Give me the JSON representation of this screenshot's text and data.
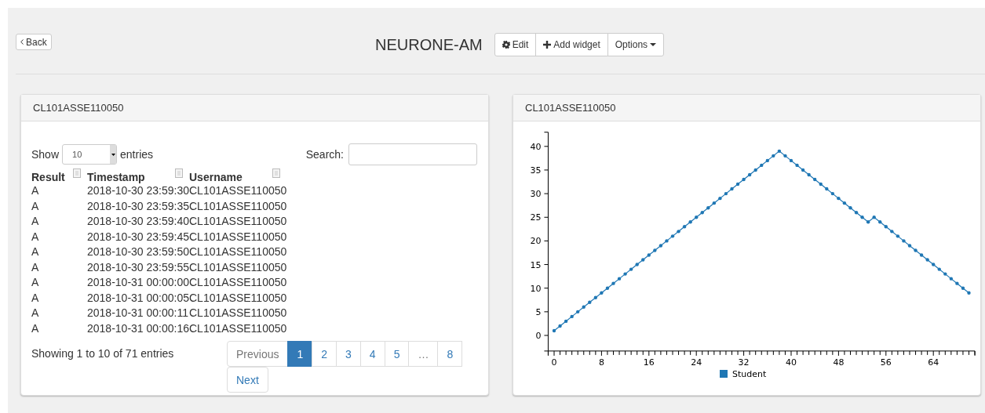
{
  "header": {
    "back": "Back",
    "title": "NEURONE-AM",
    "buttons": [
      {
        "label": "Edit",
        "kind": "gear"
      },
      {
        "label": "Add widget",
        "kind": "plus"
      },
      {
        "label": "Options",
        "kind": "caret"
      }
    ]
  },
  "table_widget": {
    "title": "CL101ASSE110050",
    "length": {
      "before": "Show",
      "value": "10",
      "after": "entries"
    },
    "search": {
      "label": "Search:"
    },
    "columns": [
      "Result",
      "Timestamp",
      "Username"
    ],
    "rows": [
      [
        "A",
        "2018-10-30 23:59:30",
        "CL101ASSE110050"
      ],
      [
        "A",
        "2018-10-30 23:59:35",
        "CL101ASSE110050"
      ],
      [
        "A",
        "2018-10-30 23:59:40",
        "CL101ASSE110050"
      ],
      [
        "A",
        "2018-10-30 23:59:45",
        "CL101ASSE110050"
      ],
      [
        "A",
        "2018-10-30 23:59:50",
        "CL101ASSE110050"
      ],
      [
        "A",
        "2018-10-30 23:59:55",
        "CL101ASSE110050"
      ],
      [
        "A",
        "2018-10-31 00:00:00",
        "CL101ASSE110050"
      ],
      [
        "A",
        "2018-10-31 00:00:05",
        "CL101ASSE110050"
      ],
      [
        "A",
        "2018-10-31 00:00:11",
        "CL101ASSE110050"
      ],
      [
        "A",
        "2018-10-31 00:00:16",
        "CL101ASSE110050"
      ]
    ],
    "info": "Showing 1 to 10 of 71 entries",
    "pagination": [
      {
        "label": "Previous",
        "selected": false,
        "disabled": true
      },
      {
        "label": "1",
        "selected": true,
        "disabled": false
      },
      {
        "label": "2",
        "selected": false,
        "disabled": false
      },
      {
        "label": "3",
        "selected": false,
        "disabled": false
      },
      {
        "label": "4",
        "selected": false,
        "disabled": false
      },
      {
        "label": "5",
        "selected": false,
        "disabled": false
      },
      {
        "label": "…",
        "selected": false,
        "disabled": true
      },
      {
        "label": "8",
        "selected": false,
        "disabled": false
      },
      {
        "label": "Next",
        "selected": false,
        "disabled": false
      }
    ]
  },
  "chart_widget": {
    "title": "CL101ASSE110050",
    "chart_data": {
      "type": "line",
      "x": [
        0,
        1,
        2,
        3,
        4,
        5,
        6,
        7,
        8,
        9,
        10,
        11,
        12,
        13,
        14,
        15,
        16,
        17,
        18,
        19,
        20,
        21,
        22,
        23,
        24,
        25,
        26,
        27,
        28,
        29,
        30,
        31,
        32,
        33,
        34,
        35,
        36,
        37,
        38,
        39,
        40,
        41,
        42,
        43,
        44,
        45,
        46,
        47,
        48,
        49,
        50,
        51,
        52,
        53,
        54,
        55,
        56,
        57,
        58,
        59,
        60,
        61,
        62,
        63,
        64,
        65,
        66,
        67,
        68,
        69,
        70
      ],
      "series": [
        {
          "name": "Student",
          "color": "#1f77b4",
          "values": [
            1,
            2,
            3,
            4,
            5,
            6,
            7,
            8,
            9,
            10,
            11,
            12,
            13,
            14,
            15,
            16,
            17,
            18,
            19,
            20,
            21,
            22,
            23,
            24,
            25,
            26,
            27,
            28,
            29,
            30,
            31,
            32,
            33,
            34,
            35,
            36,
            37,
            38,
            39,
            38,
            37,
            36,
            35,
            34,
            33,
            32,
            31,
            30,
            29,
            28,
            27,
            26,
            25,
            24,
            25,
            24,
            23,
            22,
            21,
            20,
            19,
            18,
            17,
            16,
            15,
            14,
            13,
            12,
            11,
            10,
            9
          ]
        }
      ],
      "xlim": [
        -1,
        71
      ],
      "ylim": [
        -3.3,
        43
      ],
      "xticks": [
        0,
        8,
        16,
        24,
        32,
        40,
        48,
        56,
        64
      ],
      "yticks": [
        0,
        5,
        10,
        15,
        20,
        25,
        30,
        35,
        40
      ]
    }
  }
}
